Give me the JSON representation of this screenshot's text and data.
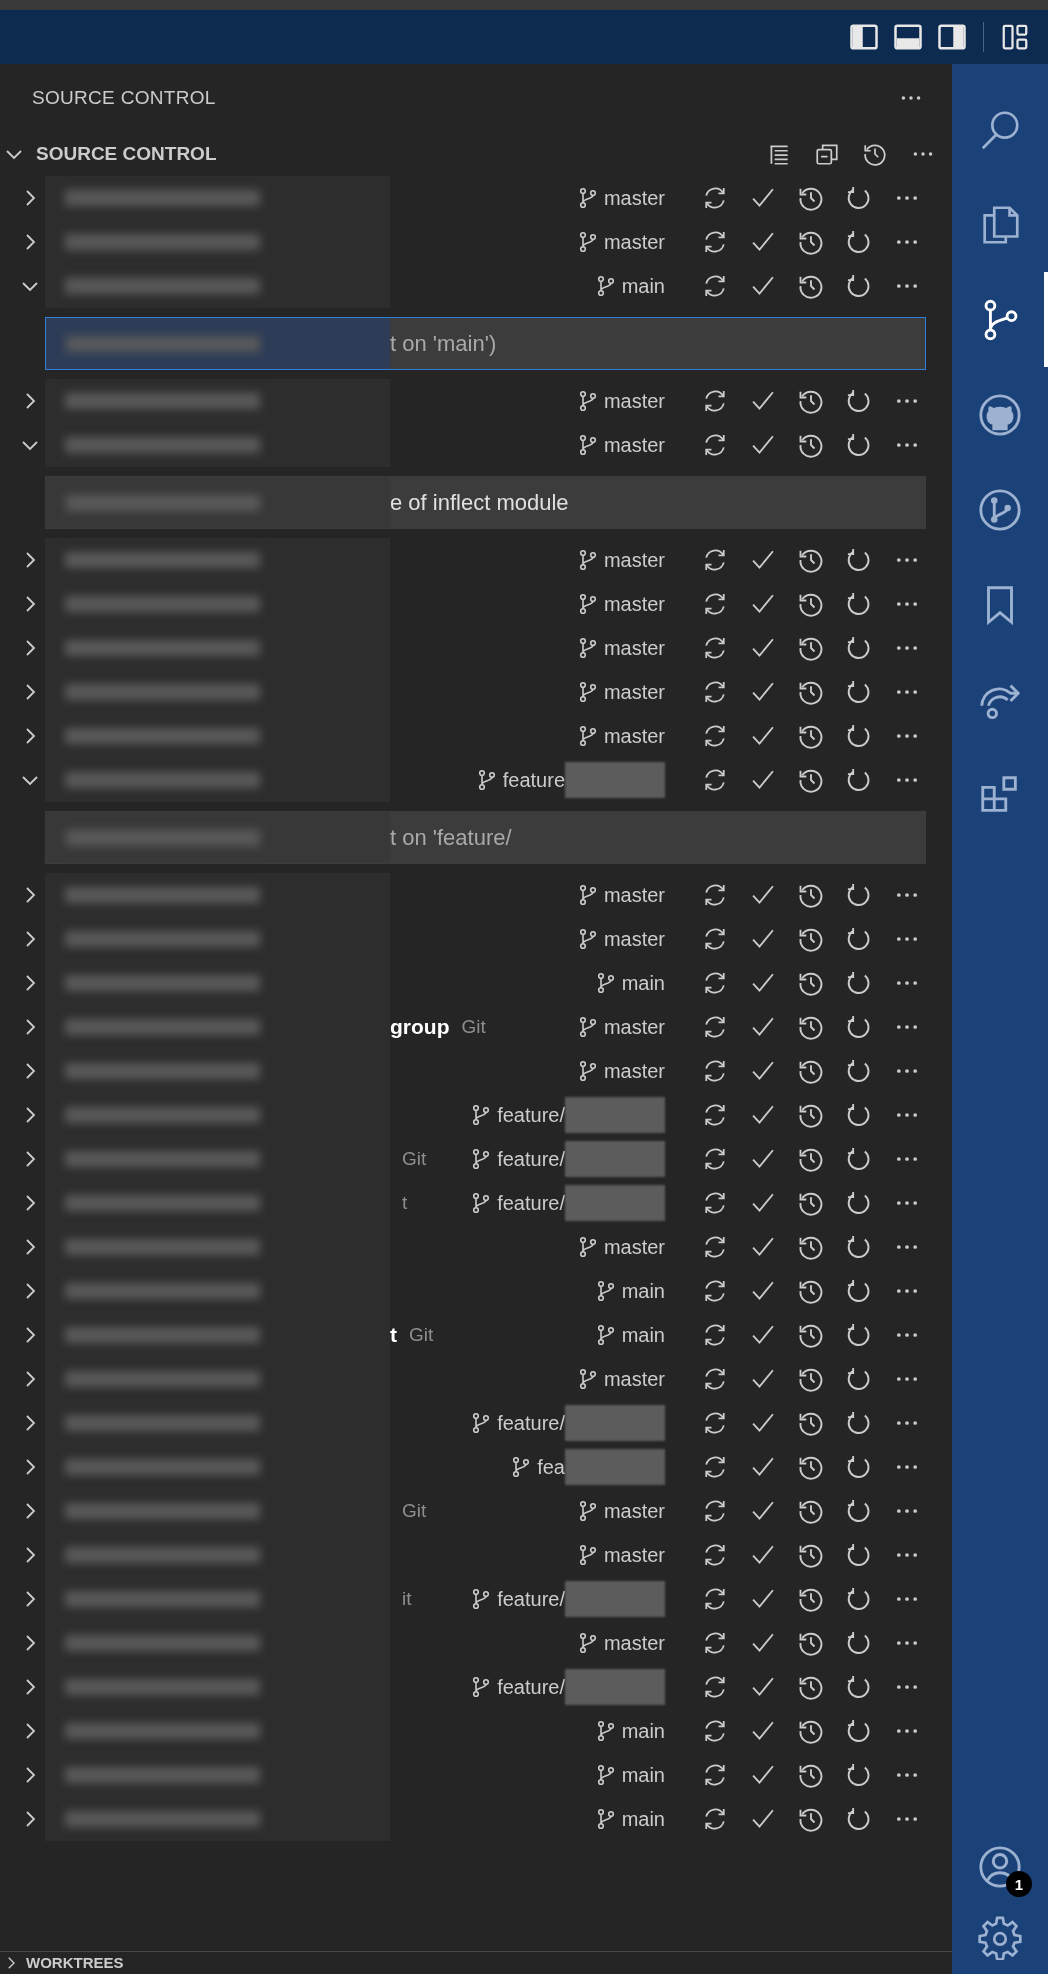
{
  "panel": {
    "title": "SOURCE CONTROL"
  },
  "section": {
    "title": "SOURCE CONTROL",
    "expanded": true
  },
  "repositories": [
    {
      "expanded": false,
      "branch": "master",
      "branch_redacted": false
    },
    {
      "expanded": false,
      "branch": "master",
      "branch_redacted": false
    },
    {
      "expanded": true,
      "branch": "main",
      "branch_redacted": false,
      "commit_box": {
        "kind": "placeholder",
        "text": "t on 'main')",
        "focused": true
      }
    },
    {
      "expanded": false,
      "branch": "master",
      "branch_redacted": false
    },
    {
      "expanded": true,
      "branch": "master",
      "branch_redacted": false,
      "commit_box": {
        "kind": "message",
        "text": "e of inflect module",
        "focused": false
      }
    },
    {
      "expanded": false,
      "branch": "master",
      "branch_redacted": false
    },
    {
      "expanded": false,
      "branch": "master",
      "branch_redacted": false
    },
    {
      "expanded": false,
      "branch": "master",
      "branch_redacted": false
    },
    {
      "expanded": false,
      "branch": "master",
      "branch_redacted": false
    },
    {
      "expanded": false,
      "branch": "master",
      "branch_redacted": false
    },
    {
      "expanded": true,
      "branch": "feature",
      "branch_redacted": true,
      "commit_box": {
        "kind": "placeholder",
        "text": "t on 'feature/",
        "focused": false
      }
    },
    {
      "expanded": false,
      "branch": "master",
      "branch_redacted": false
    },
    {
      "expanded": false,
      "branch": "master",
      "branch_redacted": false
    },
    {
      "expanded": false,
      "branch": "main",
      "branch_redacted": false
    },
    {
      "expanded": false,
      "branch": "master",
      "branch_redacted": false,
      "name_tail": "group",
      "provider": "Git"
    },
    {
      "expanded": false,
      "branch": "master",
      "branch_redacted": false
    },
    {
      "expanded": false,
      "branch": "feature/",
      "branch_redacted": true
    },
    {
      "expanded": false,
      "branch": "feature/",
      "branch_redacted": true,
      "provider": "Git"
    },
    {
      "expanded": false,
      "branch": "feature/",
      "branch_redacted": true,
      "provider": "t"
    },
    {
      "expanded": false,
      "branch": "master",
      "branch_redacted": false
    },
    {
      "expanded": false,
      "branch": "main",
      "branch_redacted": false
    },
    {
      "expanded": false,
      "branch": "main",
      "branch_redacted": false,
      "name_tail": "t",
      "provider": "Git"
    },
    {
      "expanded": false,
      "branch": "master",
      "branch_redacted": false
    },
    {
      "expanded": false,
      "branch": "feature/",
      "branch_redacted": true
    },
    {
      "expanded": false,
      "branch": "fea",
      "branch_redacted": true
    },
    {
      "expanded": false,
      "branch": "master",
      "branch_redacted": false,
      "provider": "Git"
    },
    {
      "expanded": false,
      "branch": "master",
      "branch_redacted": false
    },
    {
      "expanded": false,
      "branch": "feature/",
      "branch_redacted": true,
      "provider": "it"
    },
    {
      "expanded": false,
      "branch": "master",
      "branch_redacted": false
    },
    {
      "expanded": false,
      "branch": "feature/",
      "branch_redacted": true
    },
    {
      "expanded": false,
      "branch": "main",
      "branch_redacted": false
    },
    {
      "expanded": false,
      "branch": "main",
      "branch_redacted": false
    },
    {
      "expanded": false,
      "branch": "main",
      "branch_redacted": false
    }
  ],
  "footer_section": {
    "title": "WORKTREES",
    "expanded": false
  },
  "activity_bar": {
    "items": [
      {
        "kind": "search",
        "selected": false
      },
      {
        "kind": "explorer",
        "selected": false
      },
      {
        "kind": "source_control",
        "selected": true
      },
      {
        "kind": "github",
        "selected": false
      },
      {
        "kind": "pull_requests",
        "selected": false
      },
      {
        "kind": "bookmarks",
        "selected": false
      },
      {
        "kind": "live_share",
        "selected": false
      },
      {
        "kind": "extensions",
        "selected": false
      }
    ],
    "account_badge": "1"
  }
}
